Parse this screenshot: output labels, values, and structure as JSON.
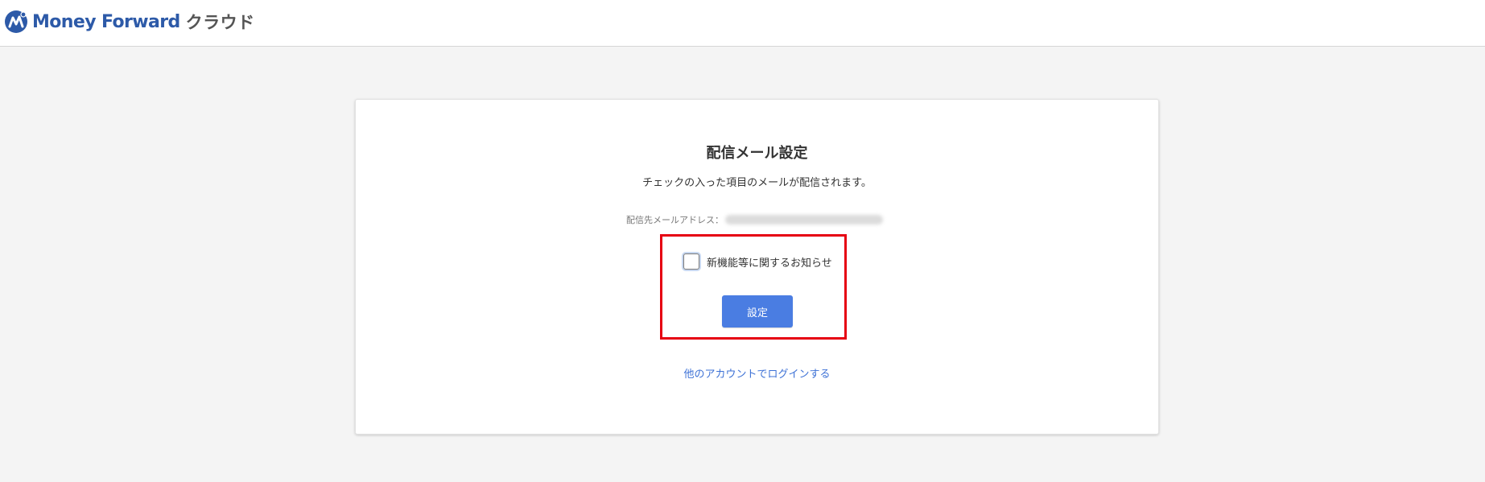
{
  "header": {
    "brand": "Money Forward",
    "brand_suffix": "クラウド"
  },
  "card": {
    "title": "配信メール設定",
    "subtitle": "チェックの入った項目のメールが配信されます。",
    "address_label": "配信先メールアドレス：",
    "address_value_blurred": true
  },
  "options": [
    {
      "label": "新機能等に関するお知らせ",
      "checked": false
    }
  ],
  "actions": {
    "submit_label": "設定",
    "other_account_link": "他のアカウントでログインする"
  },
  "colors": {
    "brand_blue": "#2d5aa8",
    "button_blue": "#4a7de2",
    "link_blue": "#3e72d6",
    "highlight_red": "#e60012"
  }
}
